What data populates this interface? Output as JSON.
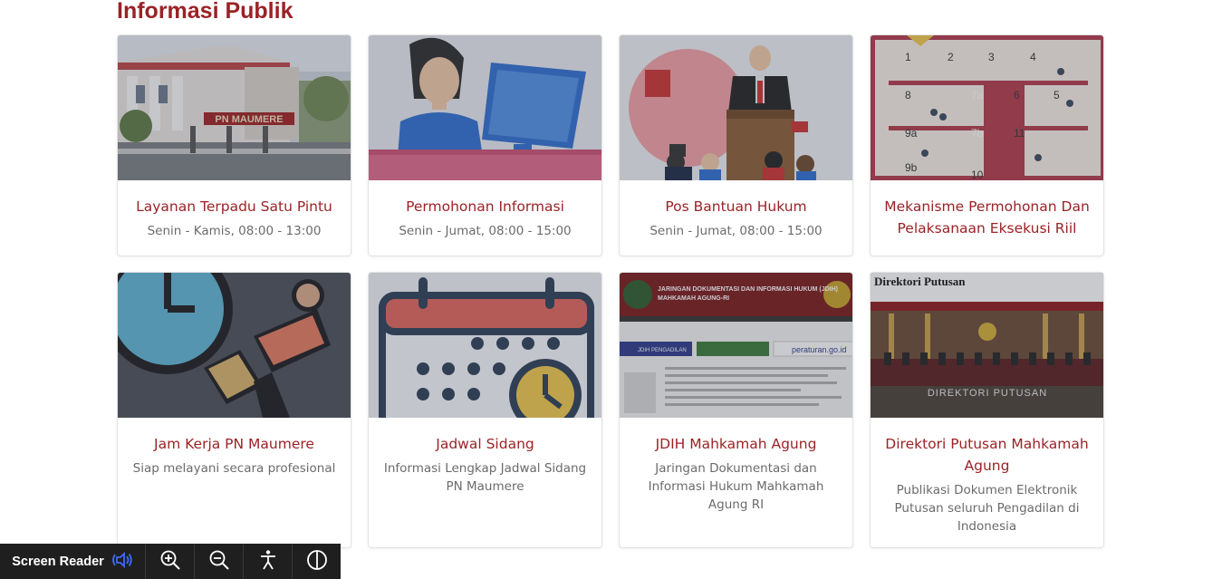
{
  "section": {
    "title": "Informasi Publik"
  },
  "cards": [
    {
      "title": "Layanan Terpadu Satu Pintu",
      "subtitle": "Senin - Kamis, 08:00 - 13:00",
      "image_text": "PN MAUMERE"
    },
    {
      "title": "Permohonan Informasi",
      "subtitle": "Senin - Jumat, 08:00 - 15:00"
    },
    {
      "title": "Pos Bantuan Hukum",
      "subtitle": "Senin - Jumat, 08:00 - 15:00"
    },
    {
      "title": "Mekanisme Permohonan Dan Pelaksanaan Eksekusi Riil",
      "subtitle": "",
      "image_numbers": [
        "1",
        "2",
        "3",
        "4",
        "8",
        "7a",
        "6",
        "5",
        "9a",
        "7b",
        "11",
        "9b",
        "10"
      ]
    },
    {
      "title": "Jam Kerja PN Maumere",
      "subtitle": "Siap melayani secara profesional"
    },
    {
      "title": "Jadwal Sidang",
      "subtitle": "Informasi Lengkap Jadwal Sidang PN Maumere"
    },
    {
      "title": "JDIH Mahkamah Agung",
      "subtitle": "Jaringan Dokumentasi dan Informasi Hukum Mahkamah Agung RI",
      "image_header_1": "JARINGAN DOKUMENTASI DAN INFORMASI HUKUM (JDIH)",
      "image_header_2": "MAHKAMAH AGUNG-RI",
      "image_link_1": "JDIH PENGADILAN",
      "image_link_2": "peraturan.go.id"
    },
    {
      "title": "Direktori Putusan Mahkamah Agung",
      "subtitle": "Publikasi Dokumen Elektronik Putusan seluruh Pengadilan di Indonesia",
      "image_header": "Direktori Putusan",
      "image_caption": "DIREKTORI PUTUSAN"
    }
  ],
  "toolbar": {
    "reader_label": "Screen Reader",
    "buttons": [
      "zoom-in",
      "zoom-out",
      "accessibility",
      "contrast"
    ]
  },
  "colors": {
    "accent": "#9b2226",
    "toolbar_bg": "#1f1f1f",
    "reader_icon": "#3b6cff"
  }
}
